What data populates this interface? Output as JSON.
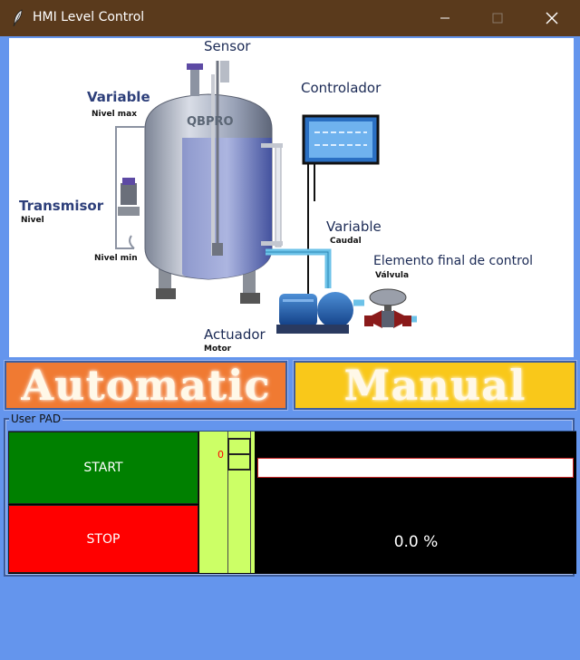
{
  "window": {
    "title": "HMI Level Control",
    "icon": "feather-icon",
    "controls": [
      "minimize-icon",
      "maximize-icon",
      "close-icon"
    ]
  },
  "diagram": {
    "labels": {
      "sensor": "Sensor",
      "controlador": "Controlador",
      "variable_top": "Variable",
      "nivel_max": "Nivel max",
      "transmisor": "Transmisor",
      "nivel": "Nivel",
      "nivel_min": "Nivel min",
      "variable_flow": "Variable",
      "caudal": "Caudal",
      "elemento": "Elemento final de control",
      "valvula": "Válvula",
      "actuador": "Actuador",
      "motor": "Motor",
      "brand": "QBPRO"
    }
  },
  "modes": {
    "automatic": "Automatic",
    "manual": "Manual",
    "automatic_color": "#f07a32",
    "manual_color": "#f9c81a"
  },
  "user_pad": {
    "title": "User PAD",
    "start_label": "START",
    "stop_label": "STOP",
    "start_color": "#008000",
    "stop_color": "#ff0000",
    "slider_value": "0",
    "level_fraction": 0.0,
    "level_text": "0.0 %"
  }
}
